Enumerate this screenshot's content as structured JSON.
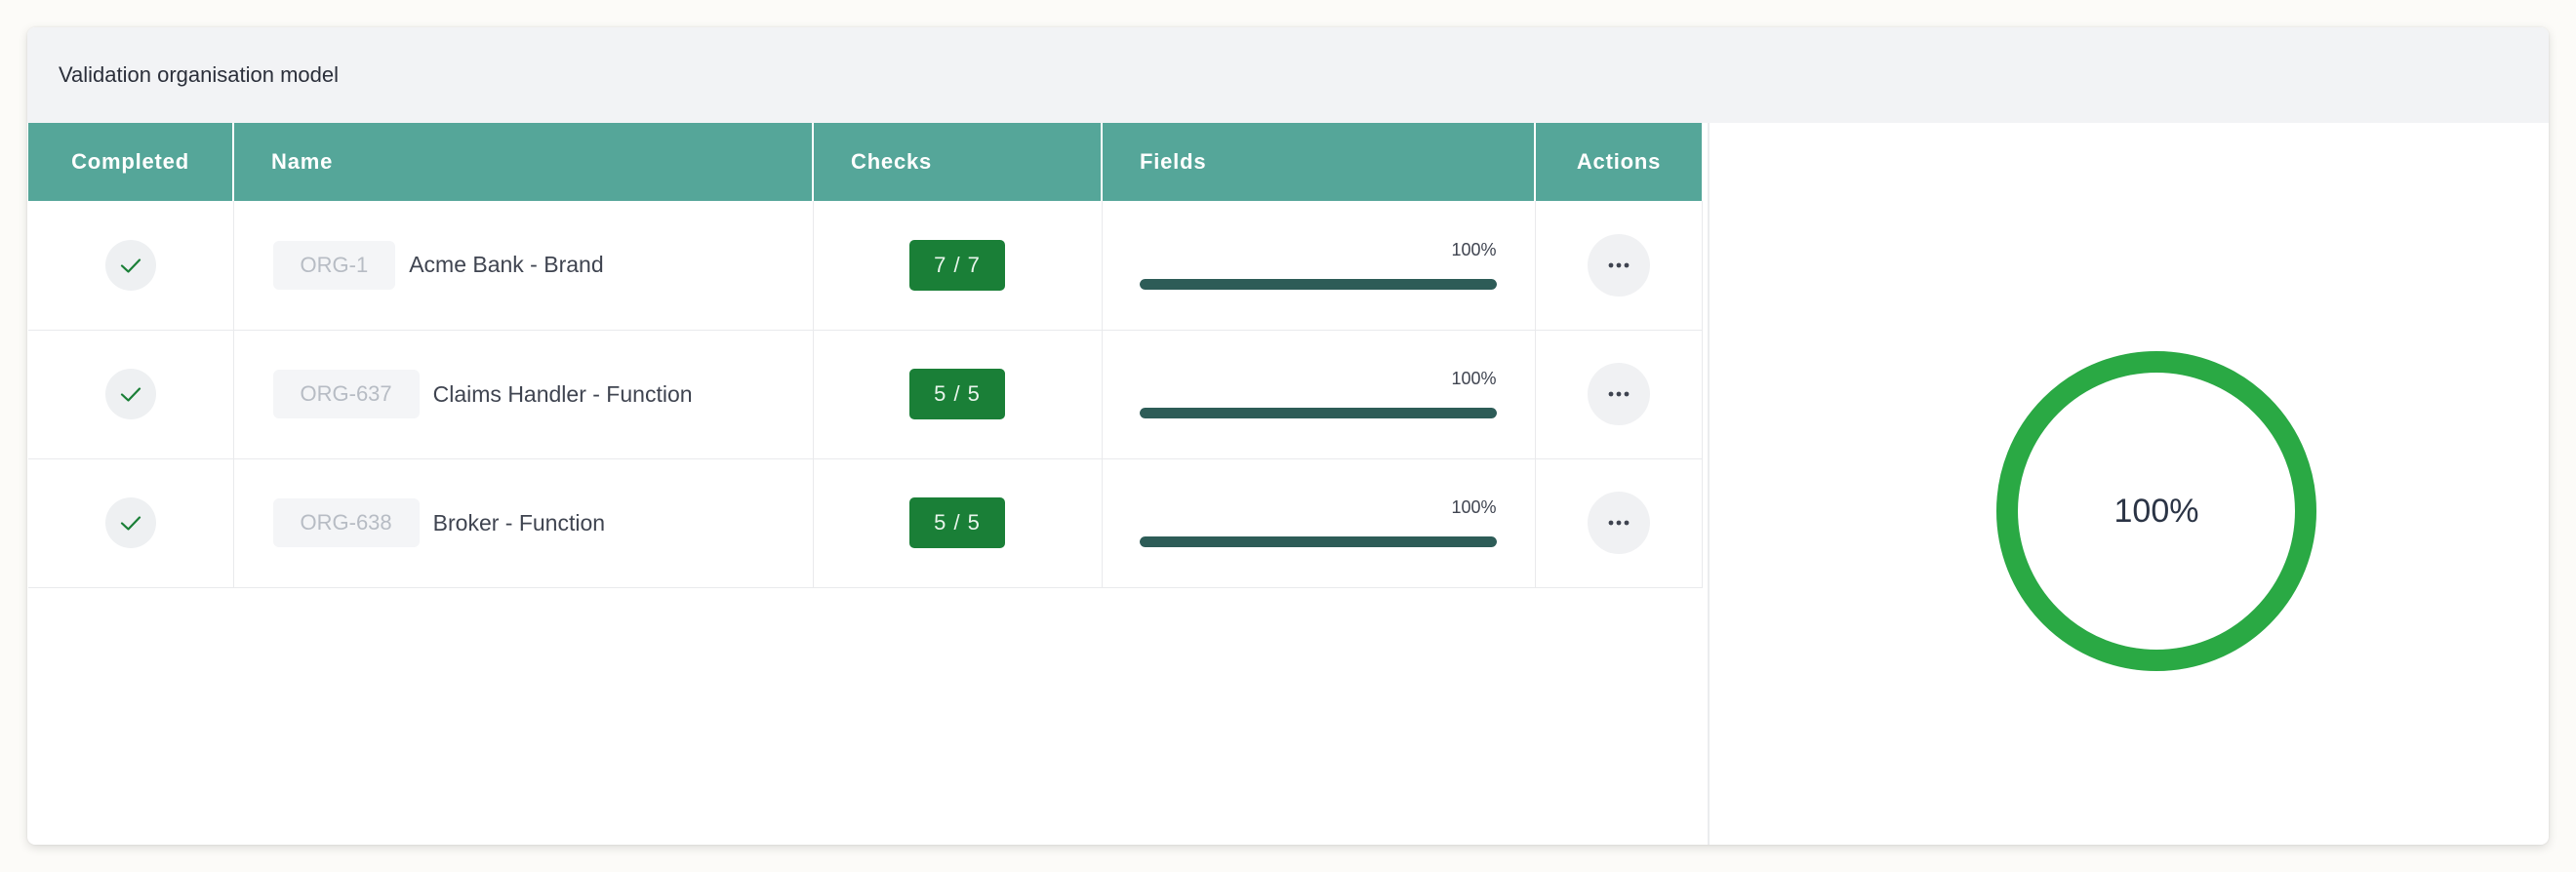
{
  "panel": {
    "title": "Validation organisation model"
  },
  "table": {
    "headers": {
      "completed": "Completed",
      "name": "Name",
      "checks": "Checks",
      "fields": "Fields",
      "actions": "Actions"
    },
    "rows": [
      {
        "completed": true,
        "code": "ORG-1",
        "name": "Acme Bank - Brand",
        "checks": "7 / 7",
        "fields_label": "100%",
        "fields_progress": 1.0
      },
      {
        "completed": true,
        "code": "ORG-637",
        "name": "Claims Handler - Function",
        "checks": "5 / 5",
        "fields_label": "100%",
        "fields_progress": 1.0
      },
      {
        "completed": true,
        "code": "ORG-638",
        "name": "Broker - Function",
        "checks": "5 / 5",
        "fields_label": "100%",
        "fields_progress": 1.0
      }
    ]
  },
  "summary": {
    "percent_label": "100%",
    "progress": 1.0
  },
  "icons": {
    "completed": "check-icon",
    "actions": "more-horizontal-icon"
  },
  "colors": {
    "header_bg": "#55a699",
    "badge_bg": "#1a7f37",
    "donut": "#2aa944",
    "bar_fill": "#2d5c57",
    "check": "#1a7f37"
  }
}
